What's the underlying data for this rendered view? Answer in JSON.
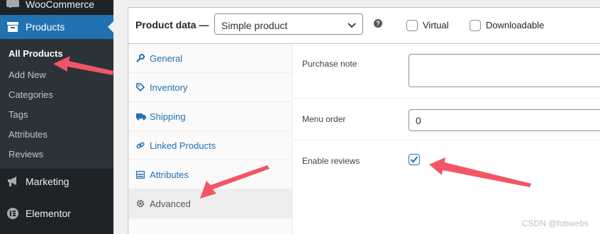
{
  "sidebar": {
    "woocommerce": "WooCommerce",
    "products": "Products",
    "submenu": [
      "All Products",
      "Add New",
      "Categories",
      "Tags",
      "Attributes",
      "Reviews"
    ],
    "marketing": "Marketing",
    "elementor": "Elementor"
  },
  "header": {
    "title": "Product data —",
    "product_type": "Simple product",
    "help": "?",
    "virtual_label": "Virtual",
    "downloadable_label": "Downloadable"
  },
  "tabs": [
    "General",
    "Inventory",
    "Shipping",
    "Linked Products",
    "Attributes",
    "Advanced"
  ],
  "active_tab": "Advanced",
  "advanced": {
    "purchase_note_label": "Purchase note",
    "purchase_note_value": "",
    "menu_order_label": "Menu order",
    "menu_order_value": "0",
    "enable_reviews_label": "Enable reviews",
    "enable_reviews_checked": true
  },
  "watermark": "CSDN @fobwebs",
  "colors": {
    "accent": "#2271b1",
    "annotation_arrow": "#f25565"
  }
}
